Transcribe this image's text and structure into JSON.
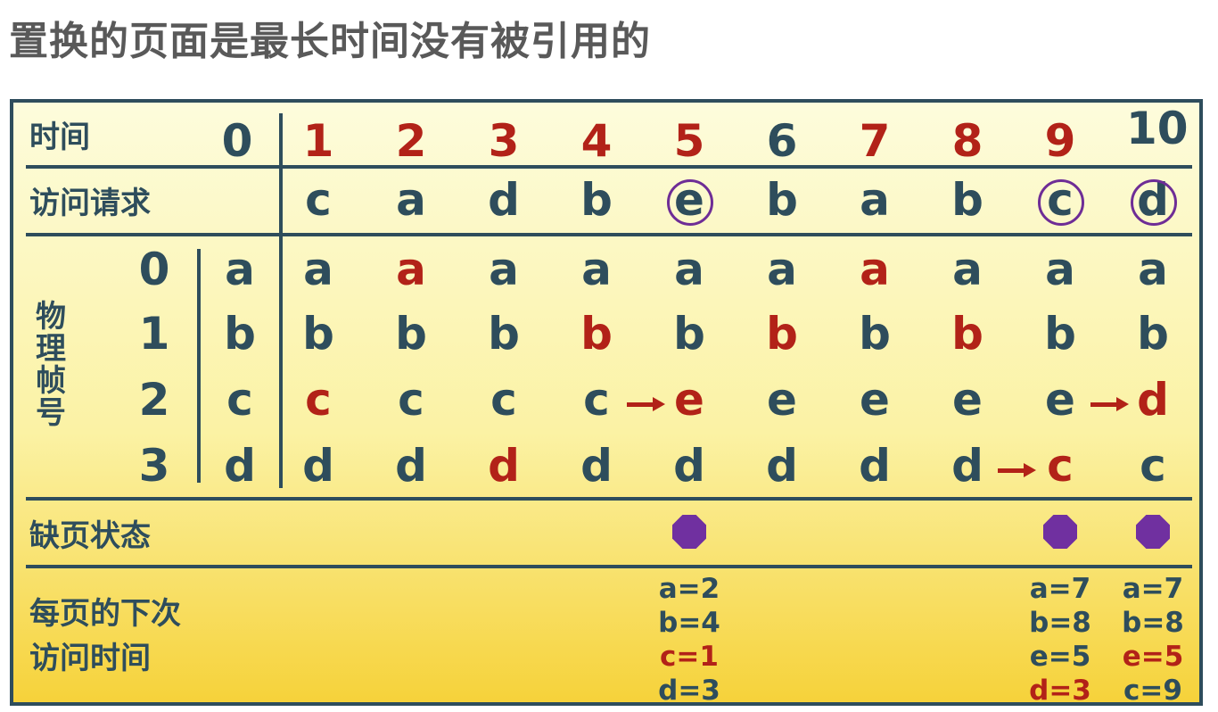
{
  "title": "置换的页面是最长时间没有被引用的",
  "labels": {
    "time": "时间",
    "request": "访问请求",
    "frames": "物理帧号",
    "fault": "缺页状态",
    "next_access_line1": "每页的下次",
    "next_access_line2": "访问时间"
  },
  "colors": {
    "text": "#2e4d5c",
    "highlight": "#b22218",
    "fault": "#7030a0",
    "border": "#2e4d5c"
  },
  "time_initial": "0",
  "time_steps": [
    "1",
    "2",
    "3",
    "4",
    "5",
    "6",
    "7",
    "8",
    "9",
    "10"
  ],
  "time_red": [
    true,
    true,
    true,
    true,
    true,
    false,
    true,
    true,
    true,
    false
  ],
  "requests": [
    "c",
    "a",
    "d",
    "b",
    "e",
    "b",
    "a",
    "b",
    "c",
    "d"
  ],
  "requests_circled": [
    false,
    false,
    false,
    false,
    true,
    false,
    false,
    false,
    true,
    true
  ],
  "frame_numbers": [
    "0",
    "1",
    "2",
    "3"
  ],
  "initial_frames": [
    "a",
    "b",
    "c",
    "d"
  ],
  "frames": [
    [
      "a",
      "a",
      "a",
      "a",
      "a",
      "a",
      "a",
      "a",
      "a",
      "a"
    ],
    [
      "b",
      "b",
      "b",
      "b",
      "b",
      "b",
      "b",
      "b",
      "b",
      "b"
    ],
    [
      "c",
      "c",
      "c",
      "c",
      "e",
      "e",
      "e",
      "e",
      "e",
      "d"
    ],
    [
      "d",
      "d",
      "d",
      "d",
      "d",
      "d",
      "d",
      "d",
      "c",
      "c"
    ]
  ],
  "frames_red": [
    [
      false,
      true,
      false,
      false,
      false,
      false,
      true,
      false,
      false,
      false
    ],
    [
      false,
      false,
      false,
      true,
      false,
      true,
      false,
      true,
      false,
      false
    ],
    [
      true,
      false,
      false,
      false,
      true,
      false,
      false,
      false,
      false,
      true
    ],
    [
      false,
      false,
      true,
      false,
      false,
      false,
      false,
      false,
      true,
      false
    ]
  ],
  "replacements": [
    {
      "step": 5,
      "frame": 2
    },
    {
      "step": 9,
      "frame": 3
    },
    {
      "step": 10,
      "frame": 2
    }
  ],
  "page_faults": [
    5,
    9,
    10
  ],
  "next_access": [
    {
      "step": 5,
      "lines": [
        {
          "text": "a=2",
          "red": false
        },
        {
          "text": "b=4",
          "red": false
        },
        {
          "text": "c=1",
          "red": true
        },
        {
          "text": "d=3",
          "red": false
        }
      ]
    },
    {
      "step": 9,
      "lines": [
        {
          "text": "a=7",
          "red": false
        },
        {
          "text": "b=8",
          "red": false
        },
        {
          "text": "e=5",
          "red": false
        },
        {
          "text": "d=3",
          "red": true
        }
      ]
    },
    {
      "step": 10,
      "lines": [
        {
          "text": "a=7",
          "red": false
        },
        {
          "text": "b=8",
          "red": false
        },
        {
          "text": "e=5",
          "red": true
        },
        {
          "text": "c=9",
          "red": false
        }
      ]
    }
  ]
}
